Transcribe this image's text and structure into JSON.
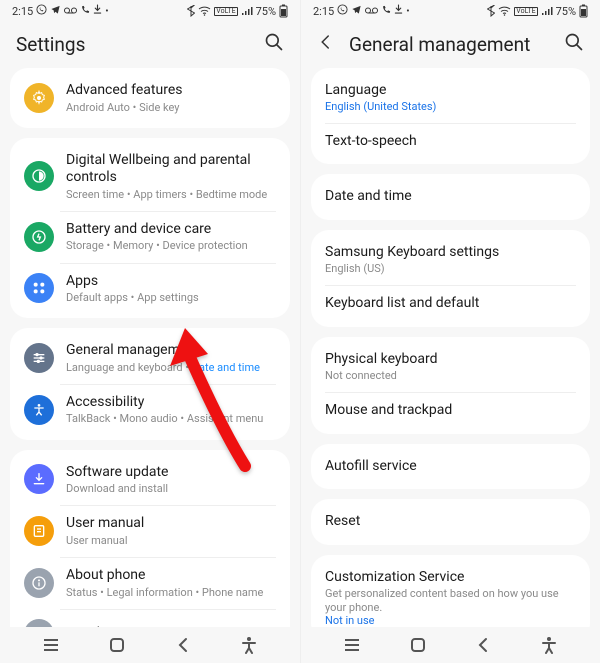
{
  "status": {
    "time": "2:15",
    "battery": "75%"
  },
  "left": {
    "title": "Settings",
    "groups": [
      {
        "rows": [
          {
            "icon": "gear-mono",
            "bg": "#f0b429",
            "title": "Advanced features",
            "sub": "Android Auto  •  Side key"
          }
        ]
      },
      {
        "rows": [
          {
            "icon": "wellbeing",
            "bg": "#1aa864",
            "title": "Digital Wellbeing and parental controls",
            "sub": "Screen time  •  App timers  •  Bedtime mode"
          },
          {
            "icon": "battery-care",
            "bg": "#1aa864",
            "title": "Battery and device care",
            "sub": "Storage  •  Memory  •  Device protection"
          },
          {
            "icon": "apps",
            "bg": "#3b82f6",
            "title": "Apps",
            "sub": "Default apps  •  App settings"
          }
        ]
      },
      {
        "rows": [
          {
            "icon": "sliders",
            "bg": "#64748b",
            "title": "General management",
            "sub_html": "Language and keyboard  •  <span class='hl'>Date and time</span>"
          },
          {
            "icon": "accessibility",
            "bg": "#1e6fd9",
            "title": "Accessibility",
            "sub": "TalkBack  •  Mono audio  •  Assistant menu"
          }
        ]
      },
      {
        "rows": [
          {
            "icon": "download",
            "bg": "#5b6cff",
            "title": "Software update",
            "sub": "Download and install"
          },
          {
            "icon": "manual",
            "bg": "#f59e0b",
            "title": "User manual",
            "sub": "User manual"
          },
          {
            "icon": "info",
            "bg": "#9aa3af",
            "title": "About phone",
            "sub": "Status  •  Legal information  •  Phone name"
          },
          {
            "icon": "dev",
            "bg": "#9aa3af",
            "title": "Developer options"
          }
        ]
      }
    ]
  },
  "right": {
    "title": "General management",
    "groups": [
      {
        "rows": [
          {
            "title": "Language",
            "sub_link": "English (United States)"
          },
          {
            "title": "Text-to-speech"
          }
        ]
      },
      {
        "rows": [
          {
            "title": "Date and time"
          }
        ]
      },
      {
        "rows": [
          {
            "title": "Samsung Keyboard settings",
            "sub": "English (US)"
          },
          {
            "title": "Keyboard list and default"
          }
        ]
      },
      {
        "rows": [
          {
            "title": "Physical keyboard",
            "sub": "Not connected"
          },
          {
            "title": "Mouse and trackpad"
          }
        ]
      },
      {
        "rows": [
          {
            "title": "Autofill service"
          }
        ]
      },
      {
        "rows": [
          {
            "title": "Reset"
          }
        ]
      },
      {
        "rows": [
          {
            "title": "Customization Service",
            "sub": "Get personalized content based on how you use your phone.",
            "extra_link": "Not in use"
          }
        ]
      }
    ]
  }
}
